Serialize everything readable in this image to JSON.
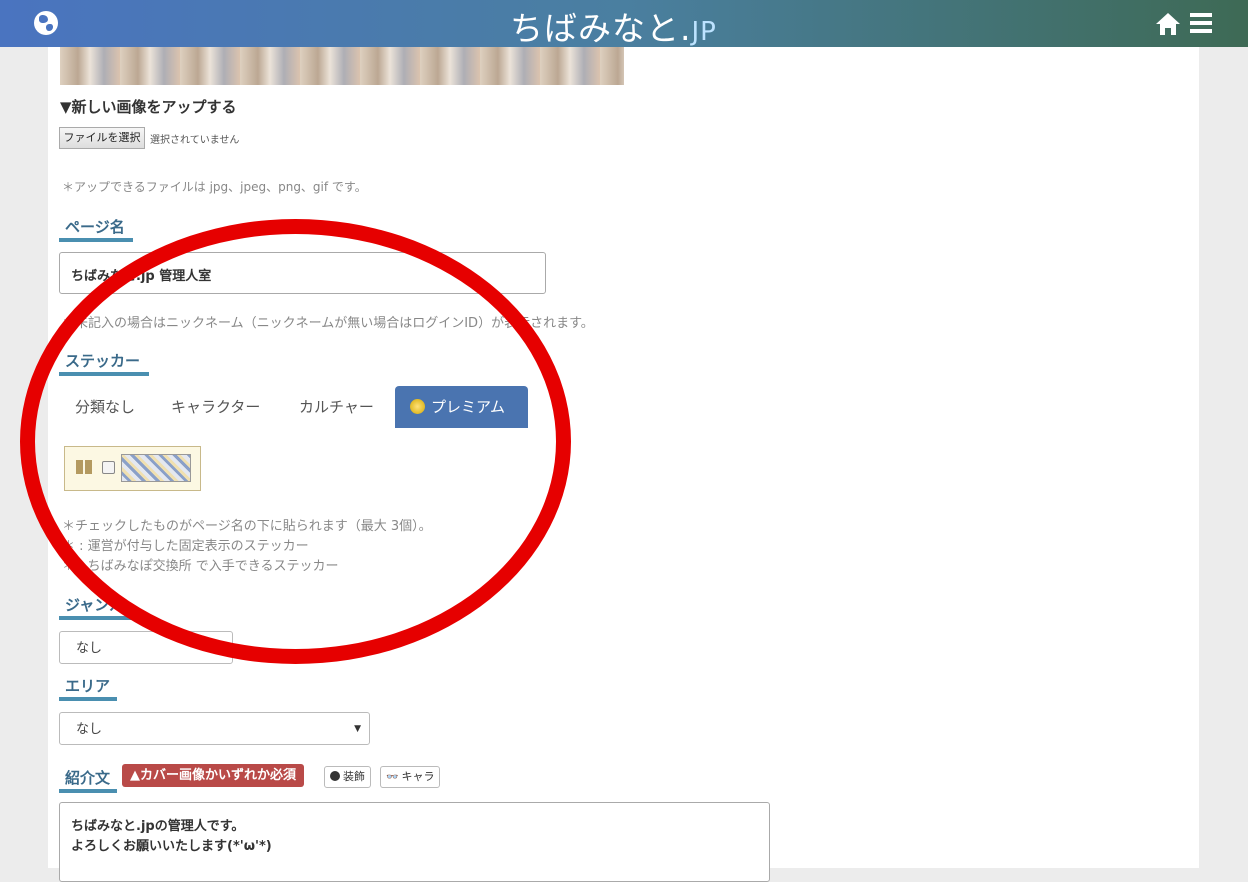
{
  "header": {
    "logo_main": "ちばみなと.",
    "logo_jp": "JP"
  },
  "upload": {
    "heading": "▼新しい画像をアップする",
    "file_button": "ファイルを選択",
    "file_status": "選択されていません",
    "note": "＊アップできるファイルは jpg、jpeg、png、gif です。"
  },
  "page_name": {
    "title": "ページ名",
    "value": "ちばみなと.jp 管理人室",
    "note": "＊未記入の場合はニックネーム（ニックネームが無い場合はログインID）が表示されます。"
  },
  "sticker": {
    "title": "ステッカー",
    "tabs": [
      "分類なし",
      "キャラクター",
      "カルチャー",
      "プレミアム"
    ],
    "active_tab": "プレミアム",
    "note1": "＊チェックしたものがページ名の下に貼られます（最大 3個）。",
    "note2": "＊ : 運営が付与した固定表示のステッカー",
    "note3": "＊ : ちばみなぽ交換所 で入手できるステッカー"
  },
  "genre": {
    "title": "ジャンル",
    "value": "なし"
  },
  "area": {
    "title": "エリア",
    "value": "なし"
  },
  "intro": {
    "title": "紹介文",
    "badge": "▲カバー画像かいずれか必須",
    "decor_button": "装飾",
    "chara_button": "キャラ",
    "line1": "ちばみなと.jpの管理人です。",
    "line2": "よろしくお願いいたします(*'ω'*)"
  },
  "colors": {
    "header_start": "#4a74c0",
    "header_end": "#3e6a55",
    "accent": "#4a8fb0",
    "tab_active": "#4a74b0",
    "required_badge": "#b94a48",
    "annotation_ring": "#e60000"
  }
}
